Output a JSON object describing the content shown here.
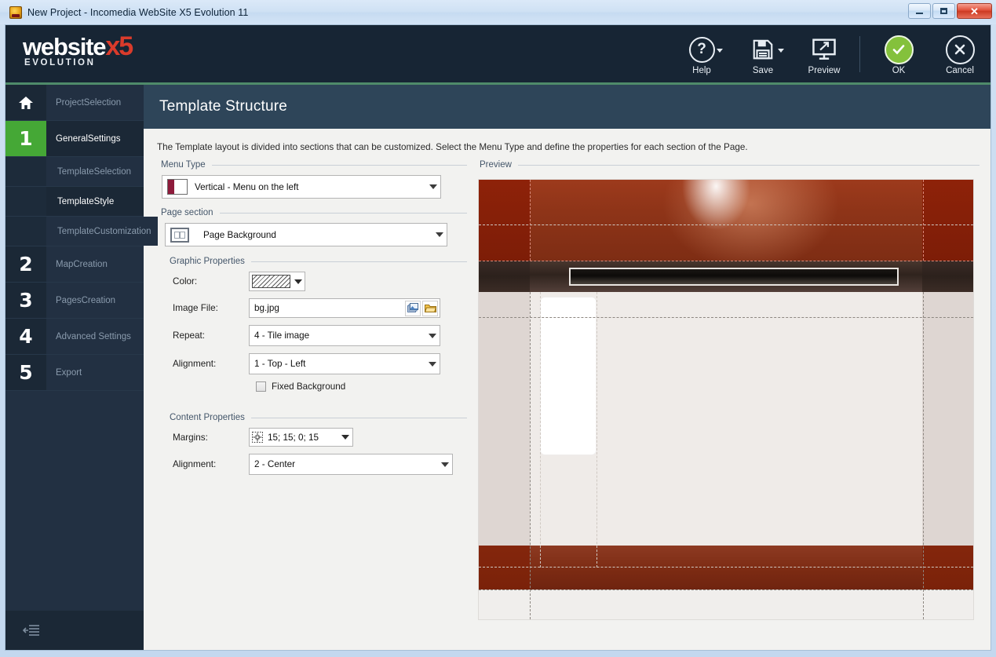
{
  "window": {
    "title": "New Project - Incomedia WebSite X5 Evolution 11",
    "app_icon": "app-icon",
    "minimize": "minimize-icon",
    "maximize": "maximize-icon",
    "close": "✕"
  },
  "brand": {
    "name": "website",
    "x5": "x5",
    "subtitle": "EVOLUTION"
  },
  "toolbar": [
    {
      "label": "Help",
      "icon": "question-mark-icon",
      "has_caret": true
    },
    {
      "label": "Save",
      "icon": "floppy-disk-icon",
      "has_caret": true
    },
    {
      "label": "Preview",
      "icon": "monitor-icon",
      "has_caret": false
    },
    {
      "label": "OK",
      "icon": "check-circle-icon",
      "has_caret": false
    },
    {
      "label": "Cancel",
      "icon": "x-circle-icon",
      "has_caret": false
    }
  ],
  "sidebar": {
    "items": [
      {
        "badge": "home",
        "label": "Project\nSelection",
        "state": "normal",
        "level": "top"
      },
      {
        "badge": "1",
        "label": "General\nSettings",
        "state": "active",
        "level": "top"
      },
      {
        "badge": "",
        "label": "Template\nSelection",
        "state": "normal",
        "level": "sub"
      },
      {
        "badge": "",
        "label": "Template\nStyle",
        "state": "selected",
        "level": "sub"
      },
      {
        "badge": "",
        "label": "Template\nCustomization",
        "state": "normal",
        "level": "sub"
      },
      {
        "badge": "2",
        "label": "Map\nCreation",
        "state": "normal",
        "level": "top"
      },
      {
        "badge": "3",
        "label": "Pages\nCreation",
        "state": "normal",
        "level": "top"
      },
      {
        "badge": "4",
        "label": "Advanced Settings",
        "state": "normal",
        "level": "top"
      },
      {
        "badge": "5",
        "label": "Export",
        "state": "normal",
        "level": "top"
      }
    ],
    "collapse_icon": "collapse-panel-icon",
    "strip_colors": [
      "#45a836",
      "#c9c13a",
      "#a8243a",
      "#c2691f",
      "#2e9ab8"
    ]
  },
  "page": {
    "title": "Template Structure",
    "description": "The Template layout is divided into sections that can be customized. Select the Menu Type and define the properties for each section of the Page."
  },
  "form": {
    "menu_type": {
      "legend": "Menu Type",
      "value": "Vertical  - Menu on the left",
      "icon": "vertical-menu-icon"
    },
    "page_section": {
      "legend": "Page section",
      "value": "Page Background",
      "icon": "page-background-icon"
    },
    "graphic_properties": {
      "legend": "Graphic Properties",
      "color": {
        "label": "Color:",
        "value": "transparent-hatch"
      },
      "image_file": {
        "label": "Image File:",
        "value": "bg.jpg",
        "placeholder": "",
        "library_button": "image-library-icon",
        "browse_button": "open-folder-icon"
      },
      "repeat": {
        "label": "Repeat:",
        "value": "4 - Tile image"
      },
      "alignment": {
        "label": "Alignment:",
        "value": "1 - Top - Left"
      },
      "fixed_background": {
        "label": "Fixed Background",
        "checked": false
      }
    },
    "content_properties": {
      "legend": "Content Properties",
      "margins": {
        "label": "Margins:",
        "value": "15; 15; 0; 15",
        "icon": "margins-icon"
      },
      "alignment": {
        "label": "Alignment:",
        "value": "2 - Center"
      }
    }
  },
  "preview": {
    "legend": "Preview",
    "colors": {
      "header_rust": "#8e3418",
      "side_band": "#8e2209",
      "dark_band": "#2c211c",
      "body": "#efebe8",
      "body_side": "#ded6d2",
      "footer": "#7a2209",
      "menu_box": "#ffffff"
    }
  }
}
